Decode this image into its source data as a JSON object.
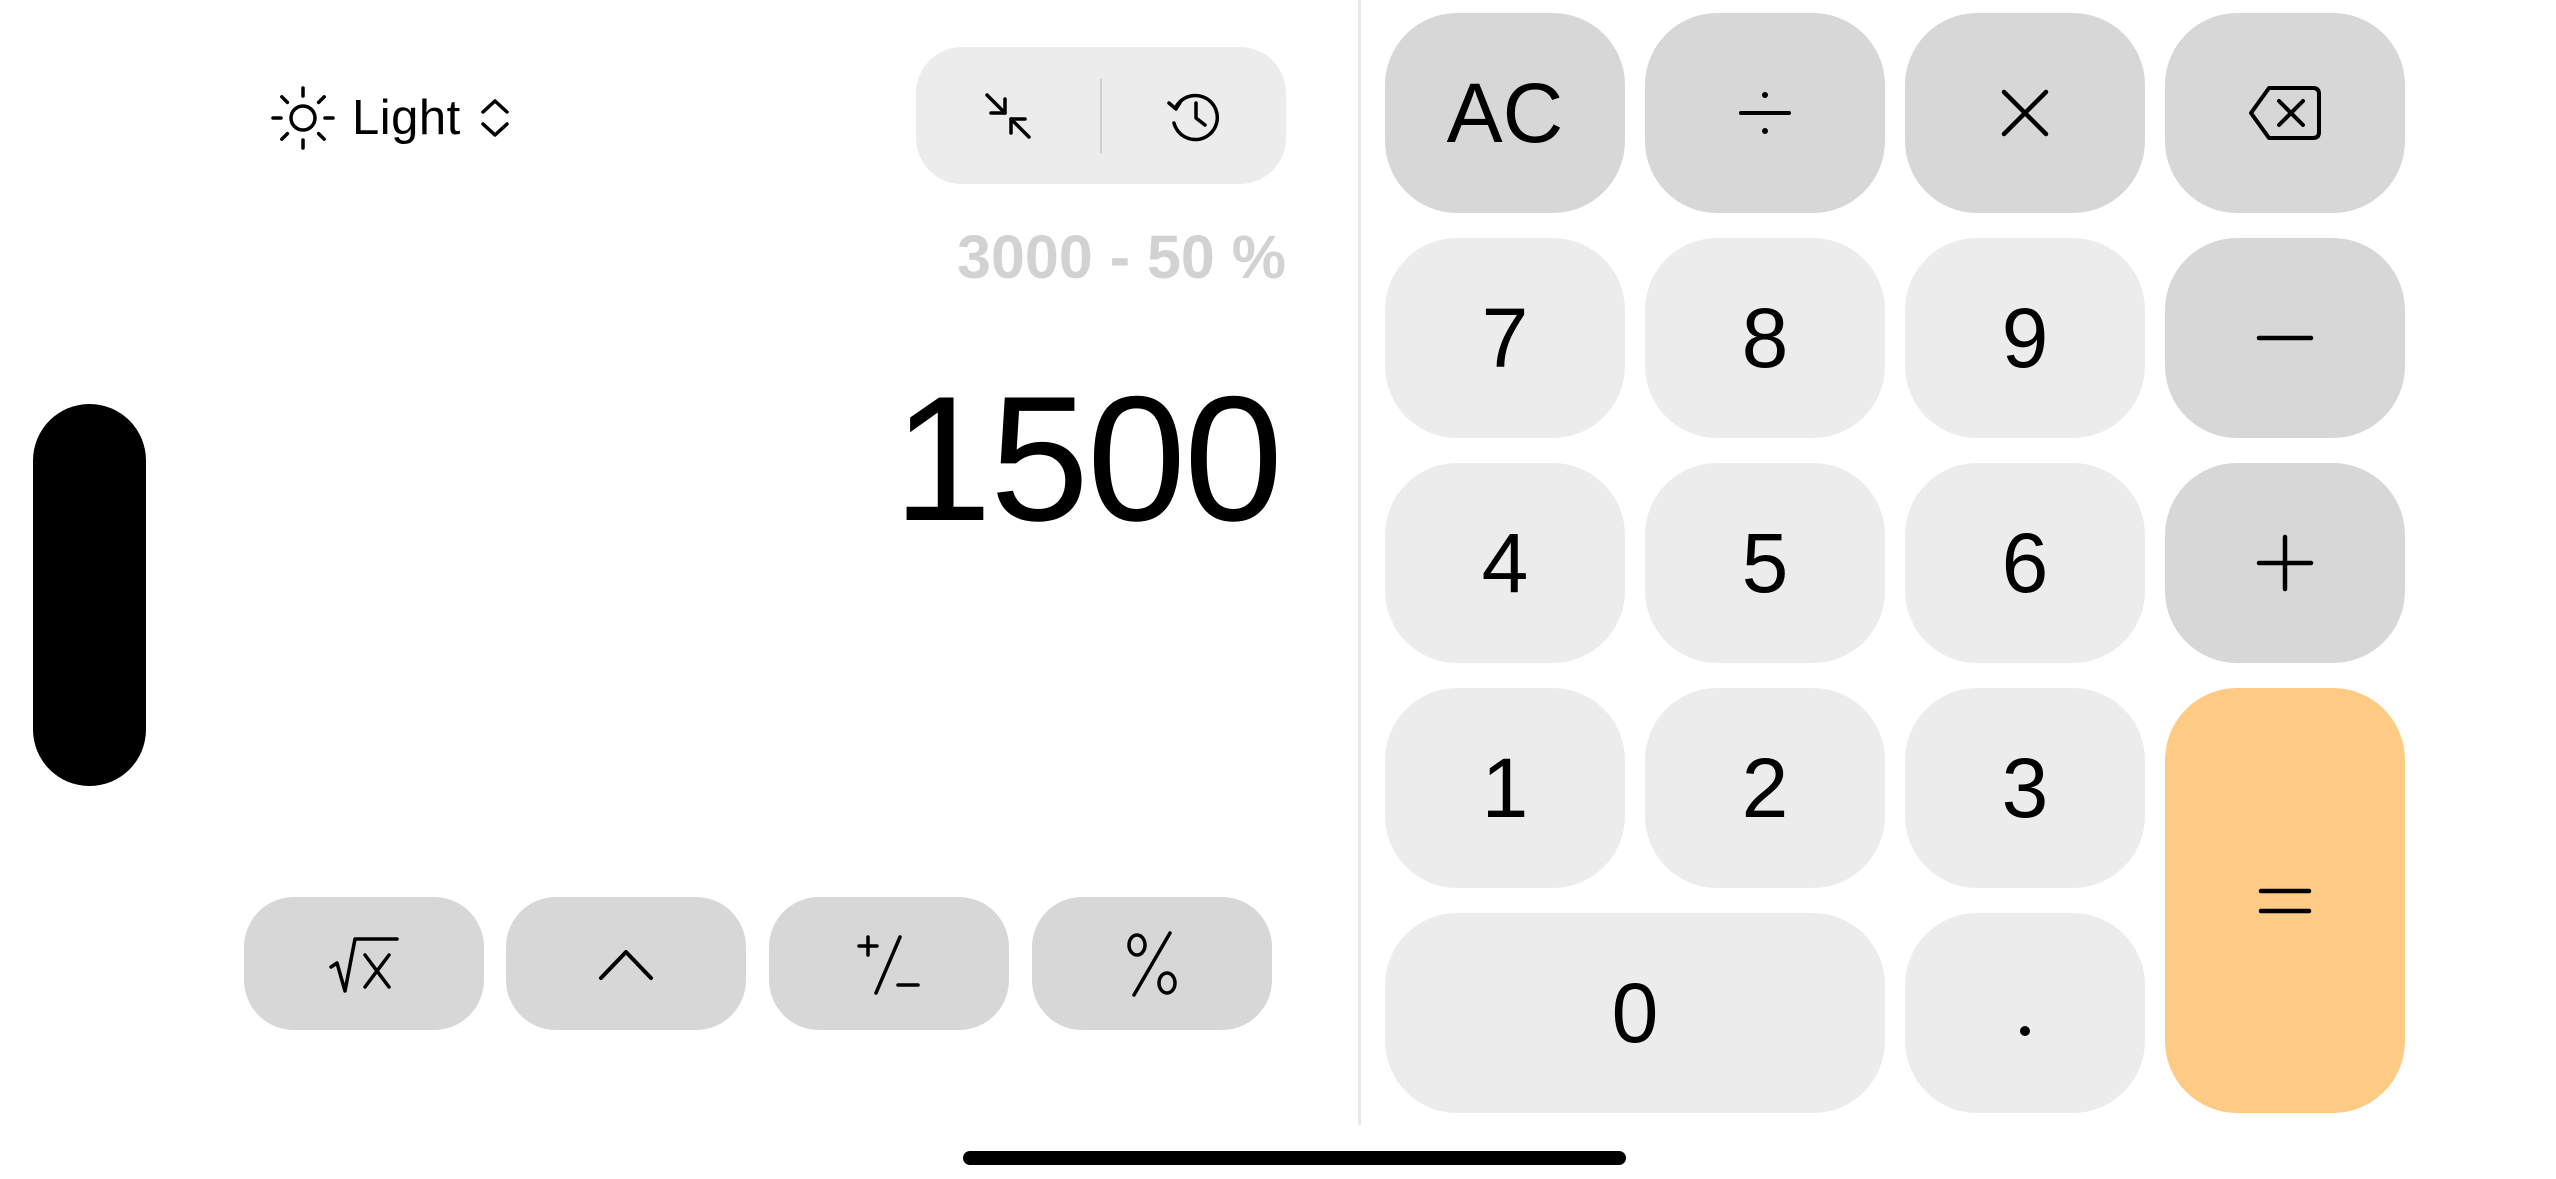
{
  "theme": {
    "icon": "sun-icon",
    "label": "Light",
    "chevron": "chevron-up-down-icon"
  },
  "tools": {
    "collapse_icon": "collapse-arrows-icon",
    "history_icon": "history-icon"
  },
  "display": {
    "expression": "3000 - 50 %",
    "result": "1500"
  },
  "scientific": [
    {
      "name": "square-root-button",
      "label": "√x"
    },
    {
      "name": "power-button",
      "label": "^"
    },
    {
      "name": "plus-minus-button",
      "label": "+/−"
    },
    {
      "name": "percent-button",
      "label": "%"
    }
  ],
  "keypad": {
    "clear": "AC",
    "divide": "÷",
    "multiply": "×",
    "backspace_icon": "backspace-icon",
    "seven": "7",
    "eight": "8",
    "nine": "9",
    "minus": "−",
    "four": "4",
    "five": "5",
    "six": "6",
    "plus": "+",
    "one": "1",
    "two": "2",
    "three": "3",
    "zero": "0",
    "decimal": ".",
    "equals": "="
  },
  "colors": {
    "number_key": "#ececec",
    "operator_key": "#d7d7d7",
    "equals_key": "#fdcb84",
    "expression_text": "#d2d2d2"
  }
}
